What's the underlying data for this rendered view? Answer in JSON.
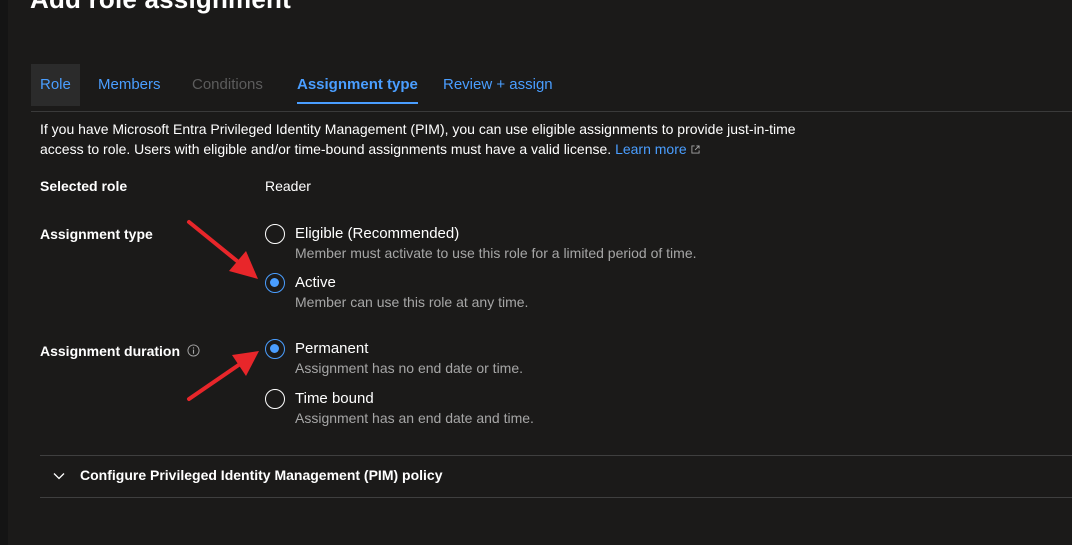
{
  "page": {
    "title": "Add role assignment"
  },
  "tabs": [
    {
      "label": "Role",
      "state": "hovered"
    },
    {
      "label": "Members",
      "state": "normal"
    },
    {
      "label": "Conditions",
      "state": "disabled"
    },
    {
      "label": "Assignment type",
      "state": "selected"
    },
    {
      "label": "Review + assign",
      "state": "normal"
    }
  ],
  "info": {
    "text": "If you have Microsoft Entra Privileged Identity Management (PIM), you can use eligible assignments to provide just-in-time access to role. Users with eligible and/or time-bound assignments must have a valid license.",
    "link": "Learn more",
    "link_icon": "external-link-icon"
  },
  "selected_role": {
    "label": "Selected role",
    "value": "Reader"
  },
  "assignment_type": {
    "label": "Assignment type",
    "options": [
      {
        "label": "Eligible (Recommended)",
        "description": "Member must activate to use this role for a limited period of time.",
        "checked": false
      },
      {
        "label": "Active",
        "description": "Member can use this role at any time.",
        "checked": true
      }
    ]
  },
  "assignment_duration": {
    "label": "Assignment duration",
    "info_icon": "info-icon",
    "options": [
      {
        "label": "Permanent",
        "description": "Assignment has no end date or time.",
        "checked": true
      },
      {
        "label": "Time bound",
        "description": "Assignment has an end date and time.",
        "checked": false
      }
    ]
  },
  "pim_policy": {
    "label": "Configure Privileged Identity Management (PIM) policy",
    "icon": "chevron-down-icon",
    "expanded": false
  },
  "colors": {
    "background": "#1b1a19",
    "accent": "#4a9eff",
    "annotation_arrow": "#e8262a",
    "muted_text": "#a6a6a6",
    "disabled_text": "#5c5c5c"
  }
}
